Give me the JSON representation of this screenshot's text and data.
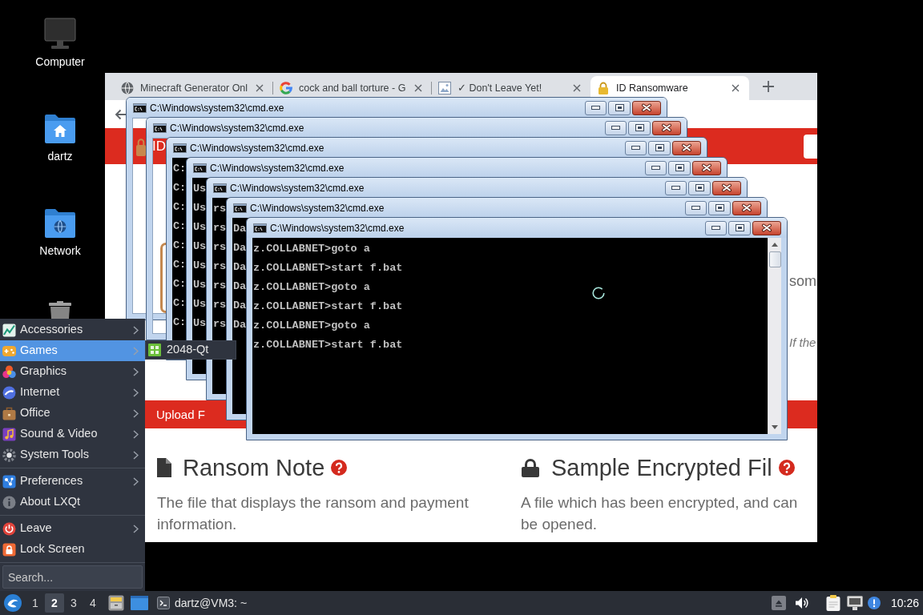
{
  "desktop_icons": [
    {
      "label": "Computer"
    },
    {
      "label": "dartz"
    },
    {
      "label": "Network"
    }
  ],
  "browser": {
    "tabs": [
      {
        "title": "Minecraft Generator Onl",
        "selected": false
      },
      {
        "title": "cock and ball torture - G",
        "selected": false
      },
      {
        "title": "✓ Don't Leave Yet!",
        "selected": false
      },
      {
        "title": "ID Ransomware",
        "selected": true
      }
    ],
    "page": {
      "header": {
        "title": "ID"
      },
      "fragments": [
        {
          "text": "som",
          "kind": "body"
        },
        {
          "text": "If the",
          "kind": "italic"
        }
      ],
      "upload_bar": {
        "label": "Upload F"
      },
      "sections": [
        {
          "heading": "Ransom Note",
          "description": "The file that displays the ransom and payment information."
        },
        {
          "heading": "Sample Encrypted Fil",
          "description_lines": [
            "A file which has been encrypted, and can",
            "be opened."
          ]
        }
      ]
    }
  },
  "cmd_windows": [
    {
      "title": "C:\\Windows\\system32\\cmd.exe",
      "kind": "transparent"
    },
    {
      "title": "C:\\Windows\\system32\\cmd.exe",
      "kind": "transparent"
    },
    {
      "title": "C:\\Windows\\system32\\cmd.exe",
      "kind": "console",
      "lines": [
        "C:",
        "C:",
        "C:",
        "C:",
        "C:",
        "C:",
        "C:",
        "C:",
        "C:"
      ]
    },
    {
      "title": "C:\\Windows\\system32\\cmd.exe",
      "kind": "console",
      "lines": [
        "Us",
        "Us",
        "Us",
        "Us",
        "Us",
        "Us",
        "Us",
        "Us"
      ]
    },
    {
      "title": "C:\\Windows\\system32\\cmd.exe",
      "kind": "console",
      "lines": [
        "rs",
        "rs",
        "rs",
        "rs",
        "rs",
        "rs",
        "rs"
      ]
    },
    {
      "title": "C:\\Windows\\system32\\cmd.exe",
      "kind": "console",
      "lines": [
        "Da",
        "Da",
        "Da",
        "Da",
        "Da",
        "Da"
      ]
    },
    {
      "title": "C:\\Windows\\system32\\cmd.exe",
      "kind": "console",
      "lines": [
        "z.COLLABNET>goto a",
        "z.COLLABNET>start f.bat",
        "z.COLLABNET>goto a",
        "z.COLLABNET>start f.bat",
        "z.COLLABNET>goto a",
        "z.COLLABNET>start f.bat"
      ]
    }
  ],
  "start_menu": {
    "sections": [
      [
        {
          "label": "Accessories",
          "has_submenu": true,
          "selected": false
        },
        {
          "label": "Games",
          "has_submenu": true,
          "selected": true
        },
        {
          "label": "Graphics",
          "has_submenu": true,
          "selected": false
        },
        {
          "label": "Internet",
          "has_submenu": true,
          "selected": false
        },
        {
          "label": "Office",
          "has_submenu": true,
          "selected": false
        },
        {
          "label": "Sound & Video",
          "has_submenu": true,
          "selected": false
        },
        {
          "label": "System Tools",
          "has_submenu": true,
          "selected": false
        }
      ],
      [
        {
          "label": "Preferences",
          "has_submenu": true,
          "selected": false
        },
        {
          "label": "About LXQt",
          "has_submenu": false,
          "selected": false
        }
      ],
      [
        {
          "label": "Leave",
          "has_submenu": true,
          "selected": false
        },
        {
          "label": "Lock Screen",
          "has_submenu": false,
          "selected": false
        }
      ]
    ],
    "search": {
      "placeholder": "Search..."
    }
  },
  "submenu": {
    "items": [
      {
        "label": "2048-Qt"
      }
    ]
  },
  "taskbar": {
    "desktops": [
      {
        "label": "1",
        "selected": false
      },
      {
        "label": "2",
        "selected": true
      },
      {
        "label": "3",
        "selected": false
      },
      {
        "label": "4",
        "selected": false
      }
    ],
    "task": {
      "label": "dartz@VM3: ~"
    },
    "clock": "10:26"
  }
}
